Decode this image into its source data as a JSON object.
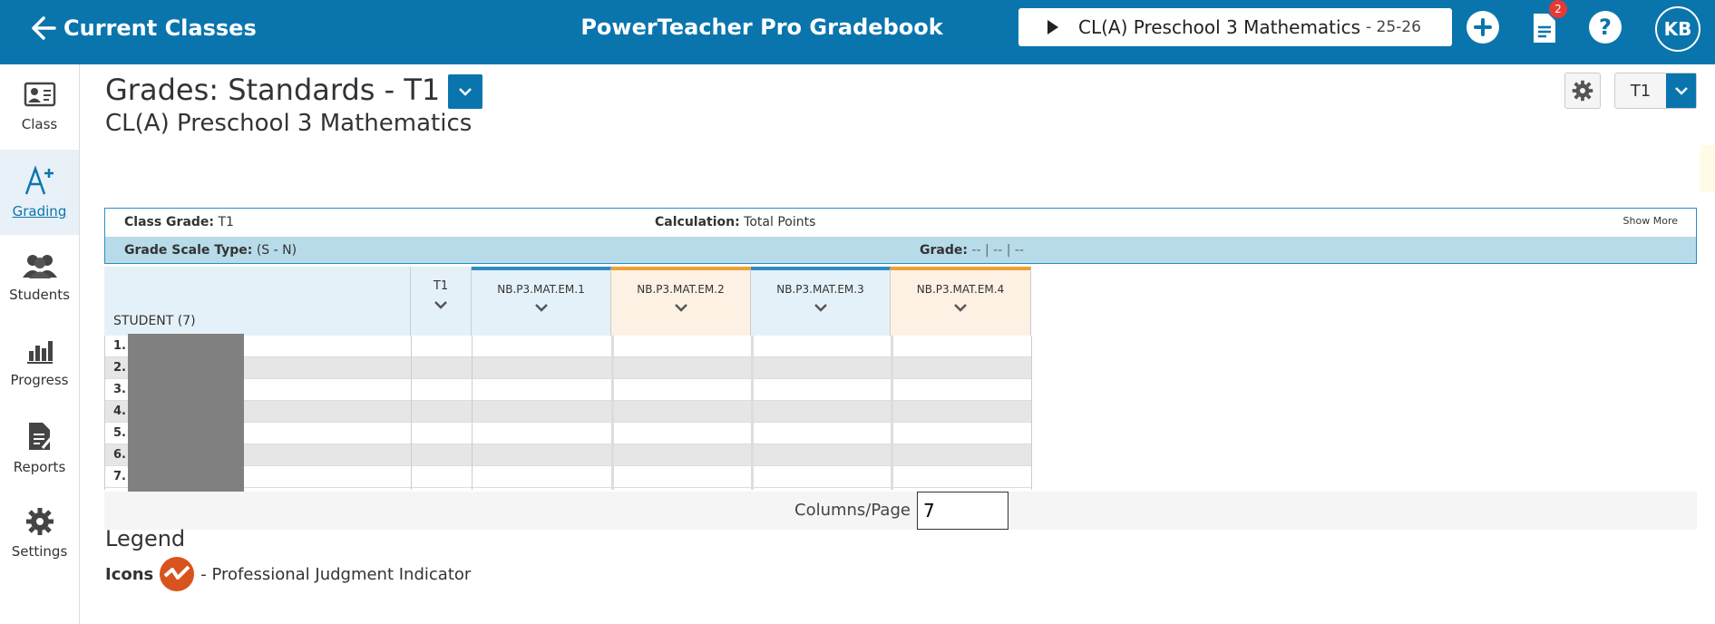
{
  "header": {
    "back_label": "Current Classes",
    "app_title": "PowerTeacher Pro Gradebook",
    "class_name": "CL(A) Preschool 3 Mathematics",
    "class_year": "- 25-26",
    "notification_count": "2",
    "help_label": "?",
    "avatar_initials": "KB"
  },
  "sidebar": {
    "items": [
      {
        "label": "Class",
        "icon": "class-icon"
      },
      {
        "label": "Grading",
        "icon": "grading-icon",
        "active": true
      },
      {
        "label": "Students",
        "icon": "students-icon"
      },
      {
        "label": "Progress",
        "icon": "progress-icon"
      },
      {
        "label": "Reports",
        "icon": "reports-icon"
      },
      {
        "label": "Settings",
        "icon": "settings-icon"
      }
    ]
  },
  "page": {
    "title": "Grades: Standards - T1",
    "subtitle": "CL(A) Preschool 3 Mathematics",
    "term_value": "T1"
  },
  "info": {
    "class_grade_label": "Class Grade:",
    "class_grade_value": "T1",
    "calculation_label": "Calculation:",
    "calculation_value": "Total Points",
    "show_more": "Show More",
    "grade_scale_label": "Grade Scale Type:",
    "grade_scale_value": "(S - N)",
    "grade_label": "Grade:",
    "grade_value": "--  |  --  |  --"
  },
  "table": {
    "student_header": "STUDENT (7)",
    "columns": [
      {
        "label": "T1",
        "color": "#e5f1f8",
        "accent": ""
      },
      {
        "label": "NB.P3.MAT.EM.1",
        "color": "#e5f1f8",
        "accent": "#2d8cc4"
      },
      {
        "label": "NB.P3.MAT.EM.2",
        "color": "#fdf1e4",
        "accent": "#f0a030"
      },
      {
        "label": "NB.P3.MAT.EM.3",
        "color": "#e5f1f8",
        "accent": "#2d8cc4"
      },
      {
        "label": "NB.P3.MAT.EM.4",
        "color": "#fdf1e4",
        "accent": "#f0a030"
      }
    ],
    "rows": [
      "1.",
      "2.",
      "3.",
      "4.",
      "5.",
      "6.",
      "7."
    ]
  },
  "pagination": {
    "columns_per_page_label": "Columns/Page",
    "columns_per_page_value": "7"
  },
  "legend": {
    "title": "Legend",
    "icons_label": "Icons",
    "pj_text": "- Professional Judgment Indicator"
  },
  "colors": {
    "brand": "#0a75ad",
    "legend_icon": "#d9531e"
  }
}
